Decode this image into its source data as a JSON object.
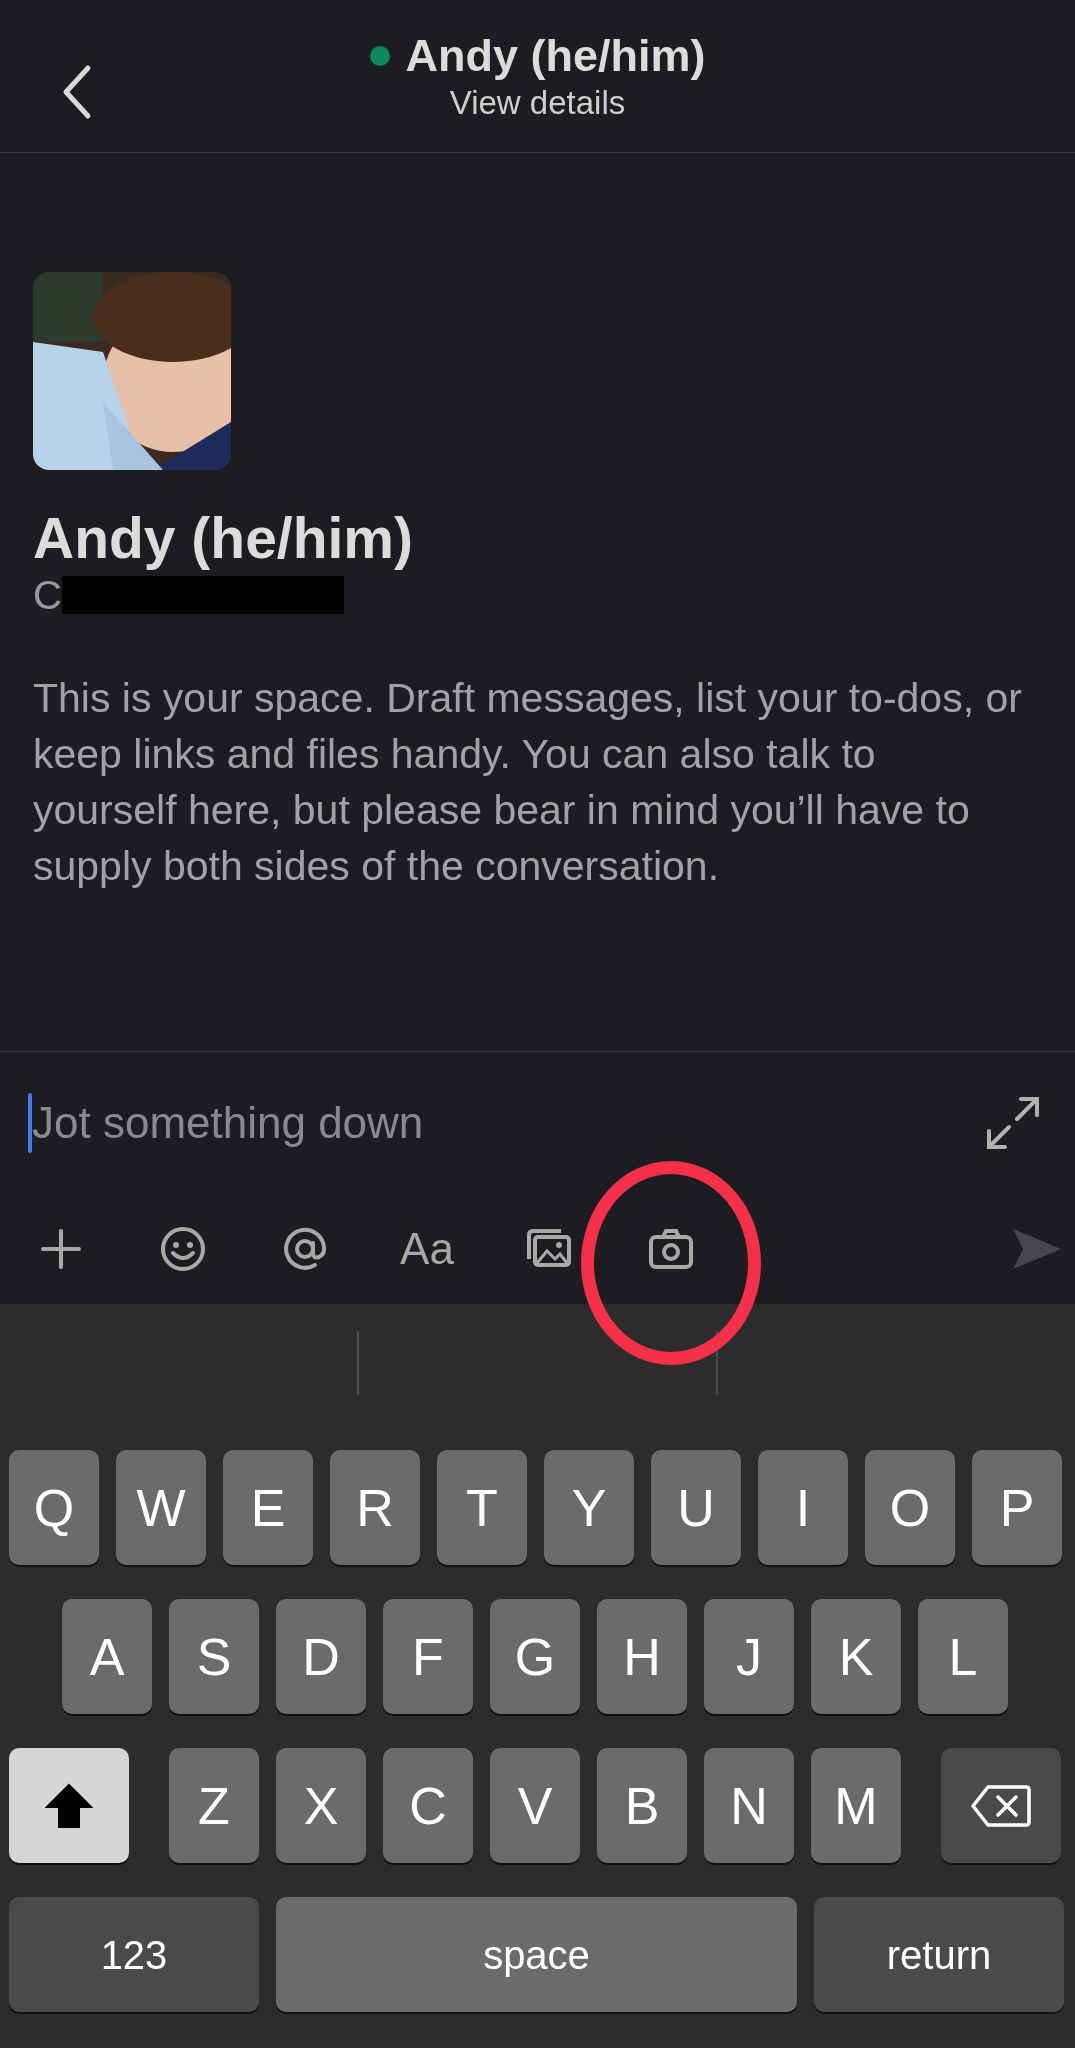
{
  "header": {
    "title": "Andy (he/him)",
    "online": true,
    "subtitle": "View details"
  },
  "profile": {
    "name": "Andy (he/him)",
    "detail_visible": "C",
    "redacted": true
  },
  "intro": "This is your space. Draft messages, list your to-dos, or keep links and files handy. You can also talk to yourself here, but please bear in mind you’ll have to supply both sides of the conversation.",
  "composer": {
    "placeholder": "Jot something down",
    "focused": true
  },
  "toolbar": [
    {
      "kind": "plus",
      "circled": false
    },
    {
      "kind": "emoji",
      "circled": false
    },
    {
      "kind": "mention",
      "circled": false
    },
    {
      "kind": "text",
      "label": "Aa",
      "circled": false
    },
    {
      "kind": "photos",
      "circled": false
    },
    {
      "kind": "camera",
      "circled": true
    }
  ],
  "send": {
    "disabled": true
  },
  "keyboard": {
    "shift_on": true,
    "rows": [
      {
        "keys": [
          {
            "kind": "letter",
            "label": "Q"
          },
          {
            "kind": "letter",
            "label": "W"
          },
          {
            "kind": "letter",
            "label": "E"
          },
          {
            "kind": "letter",
            "label": "R"
          },
          {
            "kind": "letter",
            "label": "T"
          },
          {
            "kind": "letter",
            "label": "Y"
          },
          {
            "kind": "letter",
            "label": "U"
          },
          {
            "kind": "letter",
            "label": "I"
          },
          {
            "kind": "letter",
            "label": "O"
          },
          {
            "kind": "letter",
            "label": "P"
          }
        ]
      },
      {
        "keys": [
          {
            "kind": "letter",
            "label": "A"
          },
          {
            "kind": "letter",
            "label": "S"
          },
          {
            "kind": "letter",
            "label": "D"
          },
          {
            "kind": "letter",
            "label": "F"
          },
          {
            "kind": "letter",
            "label": "G"
          },
          {
            "kind": "letter",
            "label": "H"
          },
          {
            "kind": "letter",
            "label": "J"
          },
          {
            "kind": "letter",
            "label": "K"
          },
          {
            "kind": "letter",
            "label": "L"
          }
        ]
      },
      {
        "keys": [
          {
            "kind": "shift"
          },
          {
            "kind": "letter",
            "label": "Z"
          },
          {
            "kind": "letter",
            "label": "X"
          },
          {
            "kind": "letter",
            "label": "C"
          },
          {
            "kind": "letter",
            "label": "V"
          },
          {
            "kind": "letter",
            "label": "B"
          },
          {
            "kind": "letter",
            "label": "N"
          },
          {
            "kind": "letter",
            "label": "M"
          },
          {
            "kind": "backspace"
          }
        ]
      },
      {
        "keys": [
          {
            "kind": "numbers",
            "label": "123"
          },
          {
            "kind": "space",
            "label": "space"
          },
          {
            "kind": "return",
            "label": "return"
          }
        ]
      }
    ]
  }
}
